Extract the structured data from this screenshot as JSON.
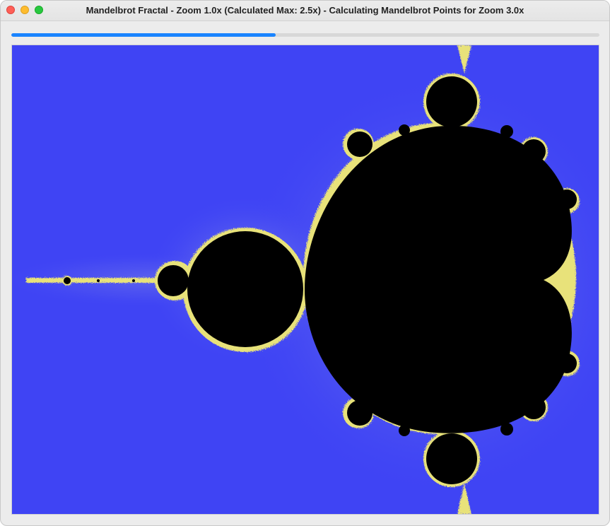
{
  "window": {
    "title": "Mandelbrot Fractal - Zoom 1.0x (Calculated Max: 2.5x) - Calculating Mandelbrot Points for Zoom 3.0x"
  },
  "progress": {
    "value_percent": 45
  },
  "colors": {
    "background": "#3f44f4",
    "set": "#000000",
    "boundary": "#e8e27a",
    "progress": "#1a84ff"
  }
}
